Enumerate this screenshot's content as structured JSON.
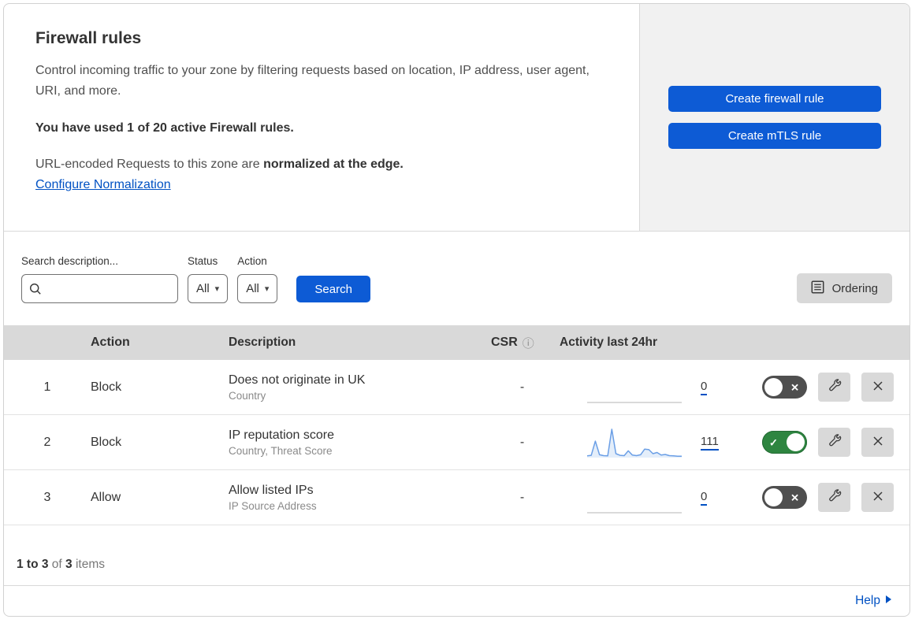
{
  "header": {
    "title": "Firewall rules",
    "description": "Control incoming traffic to your zone by filtering requests based on location, IP address, user agent, URI, and more.",
    "usage_note": "You have used 1 of 20 active Firewall rules.",
    "normalization_prefix": "URL-encoded Requests to this zone are ",
    "normalization_bold": "normalized at the edge.",
    "normalization_link": "Configure Normalization",
    "create_firewall_button": "Create firewall rule",
    "create_mtls_button": "Create mTLS rule"
  },
  "filters": {
    "search_label": "Search description...",
    "status_label": "Status",
    "status_value": "All",
    "action_label": "Action",
    "action_value": "All",
    "search_button": "Search",
    "ordering_button": "Ordering"
  },
  "table": {
    "columns": {
      "action": "Action",
      "description": "Description",
      "csr": "CSR",
      "activity": "Activity last 24hr"
    },
    "rows": [
      {
        "priority": "1",
        "action": "Block",
        "description": "Does not originate in UK",
        "criteria": "Country",
        "csr": "-",
        "activity_count": "0",
        "enabled": false,
        "sparkline": []
      },
      {
        "priority": "2",
        "action": "Block",
        "description": "IP reputation score",
        "criteria": "Country, Threat Score",
        "csr": "-",
        "activity_count": "111",
        "enabled": true,
        "sparkline": [
          6,
          8,
          58,
          10,
          7,
          6,
          100,
          14,
          8,
          7,
          24,
          9,
          7,
          10,
          30,
          28,
          14,
          18,
          9,
          11,
          7,
          6,
          5,
          5
        ]
      },
      {
        "priority": "3",
        "action": "Allow",
        "description": "Allow listed IPs",
        "criteria": "IP Source Address",
        "csr": "-",
        "activity_count": "0",
        "enabled": false,
        "sparkline": []
      }
    ]
  },
  "footer": {
    "range": "1 to 3",
    "of": "of",
    "total": "3",
    "items": "items",
    "help_label": "Help"
  },
  "colors": {
    "primary_button": "#0d5bd5",
    "link": "#0051c3",
    "toggle_on": "#2e8540",
    "toggle_off": "#4f4f4f",
    "sparkline": "#6b9fe6",
    "side_panel_gray": "#f1f1f1",
    "table_header_gray": "#d9d9d9"
  }
}
